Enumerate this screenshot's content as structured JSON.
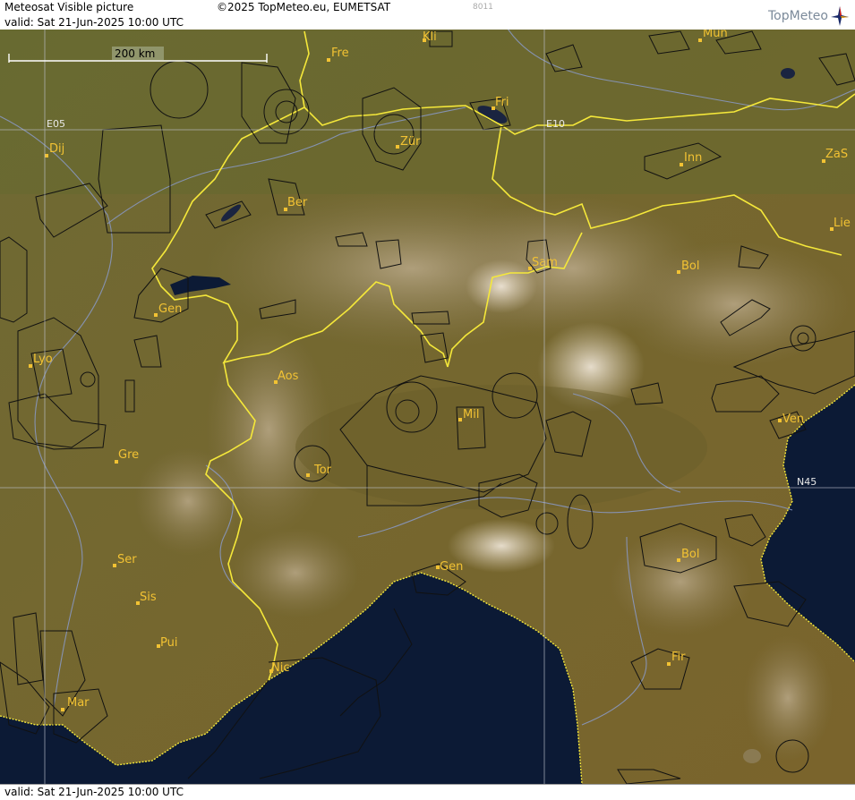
{
  "header": {
    "title": "Meteosat Visible picture",
    "copyright": "©2025 TopMeteo.eu, EUMETSAT",
    "code": "8011",
    "valid": "valid:  Sat  21-Jun-2025  10:00 UTC",
    "brand": "TopMeteo"
  },
  "footer": {
    "valid": "valid:  Sat  21-Jun-2025  10:00 UTC"
  },
  "scale": {
    "label": "200 km"
  },
  "grid": {
    "lon_e05": "E05",
    "lon_e10": "E10",
    "lat_n45": "N45"
  },
  "places": {
    "kli": "Kli",
    "mun": "Mun",
    "fre": "Fre",
    "fri": "Fri",
    "dij": "Dij",
    "zur": "Zür",
    "inn": "Inn",
    "zas": "ZaS",
    "ber": "Ber",
    "lie": "Lie",
    "sam": "Sam",
    "bol_n": "Bol",
    "gen_ch": "Gen",
    "lyo": "Lyo",
    "aos": "Aos",
    "mil": "Mil",
    "ven": "Ven",
    "gre": "Gre",
    "tor": "Tor",
    "ser": "Ser",
    "bol_s": "Bol",
    "gen_it": "Gen",
    "sis": "Sis",
    "pui": "Pui",
    "nic": "Nic",
    "fir": "Fir",
    "mar": "Mar"
  },
  "colors": {
    "land": "#6b6330",
    "sea": "#0c1a35",
    "border": "#f5e83a",
    "label": "#f2c233",
    "airspace": "#111111",
    "river": "#8a9ac8"
  }
}
